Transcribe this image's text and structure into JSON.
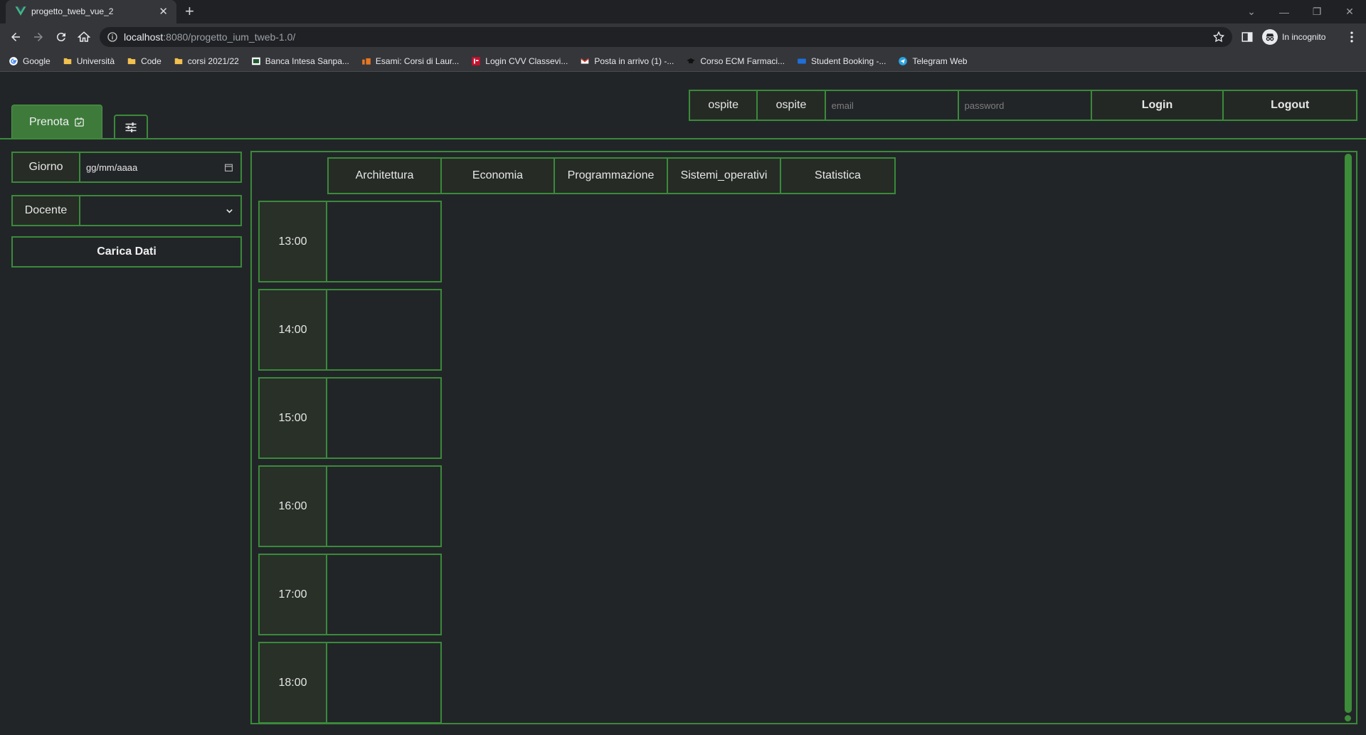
{
  "browser": {
    "tab_title": "progetto_tweb_vue_2",
    "url_host": "localhost",
    "url_path": ":8080/progetto_ium_tweb-1.0/",
    "incognito_label": "In incognito",
    "bookmarks": [
      {
        "label": "Google",
        "icon": "google-icon"
      },
      {
        "label": "Università",
        "icon": "folder-icon"
      },
      {
        "label": "Code",
        "icon": "folder-icon"
      },
      {
        "label": "corsi 2021/22",
        "icon": "folder-icon"
      },
      {
        "label": "Banca Intesa Sanpa...",
        "icon": "bank-icon"
      },
      {
        "label": "Esami: Corsi di Laur...",
        "icon": "unito-icon"
      },
      {
        "label": "Login CVV Classevi...",
        "icon": "classeviva-icon"
      },
      {
        "label": "Posta in arrivo (1) -...",
        "icon": "gmail-icon"
      },
      {
        "label": "Corso ECM Farmaci...",
        "icon": "graduation-cap-icon"
      },
      {
        "label": "Student Booking -...",
        "icon": "booking-icon"
      },
      {
        "label": "Telegram Web",
        "icon": "telegram-icon"
      }
    ]
  },
  "auth": {
    "user_name": "ospite",
    "user_surname": "ospite",
    "email_placeholder": "email",
    "password_placeholder": "password",
    "login_label": "Login",
    "logout_label": "Logout"
  },
  "tabs": {
    "prenota_label": "Prenota"
  },
  "form": {
    "day_label": "Giorno",
    "day_value": "gg/mm/aaaa",
    "teacher_label": "Docente",
    "teacher_value": "",
    "load_label": "Carica Dati"
  },
  "schedule": {
    "subjects": [
      "Architettura",
      "Economia",
      "Programmazione",
      "Sistemi_operativi",
      "Statistica"
    ],
    "slots": [
      "13:00",
      "14:00",
      "15:00",
      "16:00",
      "17:00",
      "18:00"
    ]
  },
  "colors": {
    "accent_green": "#3a8a3a",
    "active_tab": "#3e7b3b",
    "background": "#222528"
  }
}
